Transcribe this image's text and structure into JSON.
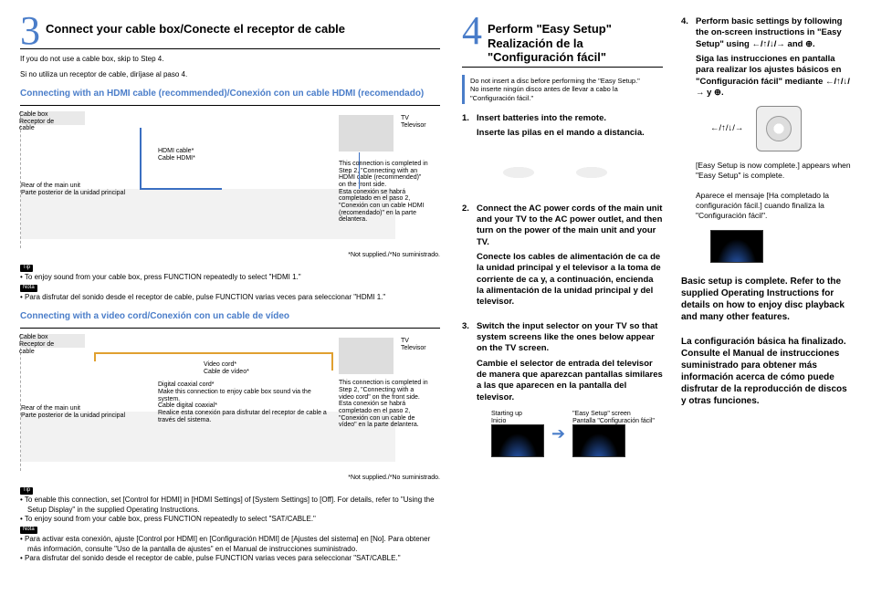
{
  "step3": {
    "num": "3",
    "title": "Connect your cable box/Conecte el receptor de cable",
    "intro_en": "If you do not use a cable box, skip to Step 4.",
    "intro_es": "Si no utiliza un receptor de cable, diríjase al paso 4.",
    "hdmi_heading": "Connecting with an HDMI cable (recommended)/Conexión con un cable HDMI (recomendado)",
    "video_heading": "Connecting with a video cord/Conexión con un cable de vídeo",
    "labels": {
      "cable_box": "Cable box\nReceptor de\ncable",
      "tv": "TV\nTelevisor",
      "hdmi_cable": "HDMI cable*\nCable HDMI*",
      "video_cord": "Video cord*\nCable de vídeo*",
      "coax": "Digital coaxial cord*\nMake this connection to enjoy cable box sound via the system.\nCable digital coaxial*\nRealice esta conexión para disfrutar del receptor de cable a través del sistema.",
      "rear": "Rear of the main unit\nParte posterior de la unidad principal",
      "conn_note_hdmi": "This connection is completed in Step 2, \"Connecting with an HDMI cable (recommended)\" on the front side.\nEsta conexión se habrá completado en el paso 2, \"Conexión con un cable HDMI (recomendado)\" en la parte delantera.",
      "conn_note_video": "This connection is completed in Step 2, \"Connecting with a video cord\" on the front side.\nEsta conexión se habrá completado en el paso 2, \"Conexión con un cable de vídeo\" en la parte delantera."
    },
    "not_supplied": "*Not supplied./*No suministrado.",
    "tip1_en": "To enjoy sound from your cable box, press FUNCTION repeatedly to select \"HDMI 1.\"",
    "tip1_es": "Para disfrutar del sonido desde el receptor de cable, pulse FUNCTION varias veces para seleccionar \"HDMI 1.\"",
    "tip2_en1": "To enable this connection, set [Control for HDMI] in [HDMI Settings] of [System Settings] to [Off]. For details, refer to \"Using the Setup Display\" in the supplied Operating Instructions.",
    "tip2_en2": "To enjoy sound from your cable box, press FUNCTION repeatedly to select \"SAT/CABLE.\"",
    "tip2_es1": "Para activar esta conexión, ajuste [Control por HDMI] en [Configuración HDMI] de [Ajustes del sistema] en [No]. Para obtener más información, consulte \"Uso de la pantalla de ajustes\" en el Manual de instrucciones suministrado.",
    "tip2_es2": "Para disfrutar del sonido desde el receptor de cable, pulse FUNCTION varias veces para seleccionar \"SAT/CABLE.\"",
    "tag_tip": "Tip",
    "tag_nota": "Nota"
  },
  "step4": {
    "num": "4",
    "title_en": "Perform \"Easy Setup\"",
    "title_es": "Realización de la \"Configuración fácil\"",
    "caution_en": "Do not insert a disc before performing the \"Easy Setup.\"",
    "caution_es": "No inserte ningún disco antes de llevar a cabo la \"Configuración fácil.\"",
    "s1_en": "Insert batteries into the remote.",
    "s1_es": "Inserte las pilas en el mando a distancia.",
    "s2_en": "Connect the AC power cords of the main unit and your TV to the AC power outlet, and then turn on the power of the main unit and your TV.",
    "s2_es": "Conecte los cables de alimentación de ca de la unidad principal y el televisor a la toma de corriente de ca y, a continuación, encienda la alimentación de la unidad principal y del televisor.",
    "s3_en": "Switch the input selector on your TV so that system screens like the ones below appear on the TV screen.",
    "s3_es": "Cambie el selector de entrada del televisor de manera que aparezcan pantallas similares a las que aparecen en la pantalla del televisor.",
    "scr_left": "Starting up\nInicio",
    "scr_right": "\"Easy Setup\" screen\nPantalla \"Configuración fácil\"",
    "s4_en": "Perform basic settings by following the on-screen instructions in \"Easy Setup\" using ←/↑/↓/→ and ⊕.",
    "s4_es": "Siga las instrucciones en pantalla para realizar los ajustes básicos en \"Configuración fácil\" mediante ←/↑/↓/→ y ⊕.",
    "arrows": "←/↑/↓/→",
    "complete_en": "[Easy Setup is now complete.] appears when \"Easy Setup\" is complete.",
    "complete_es": "Aparece el mensaje [Ha completado la configuración fácil.] cuando finaliza la \"Configuración fácil\".",
    "final_en": "Basic setup is complete. Refer to the supplied Operating Instructions for details on how to enjoy disc playback and many other features.",
    "final_es": "La configuración básica ha finalizado. Consulte el Manual de instrucciones suministrado para obtener más información acerca de cómo puede disfrutar de la reproducción de discos y otras funciones."
  }
}
